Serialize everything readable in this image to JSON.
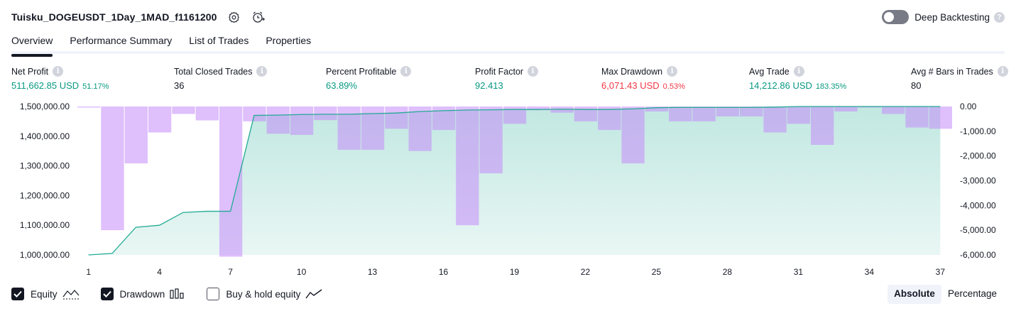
{
  "header": {
    "title": "Tuisku_DOGEUSDT_1Day_1MAD_f1161200",
    "settings_icon": "gear-icon",
    "alert_icon": "add-alert-clock-icon",
    "deep_backtesting_label": "Deep Backtesting",
    "deep_backtesting_enabled": false,
    "help_glyph": "?"
  },
  "tabs": [
    {
      "label": "Overview",
      "active": true
    },
    {
      "label": "Performance Summary",
      "active": false
    },
    {
      "label": "List of Trades",
      "active": false
    },
    {
      "label": "Properties",
      "active": false
    }
  ],
  "metrics": [
    {
      "label": "Net Profit",
      "value": "511,662.85 USD",
      "sub": "51.17%",
      "color": "#089981"
    },
    {
      "label": "Total Closed Trades",
      "value": "36",
      "sub": "",
      "color": "#131722"
    },
    {
      "label": "Percent Profitable",
      "value": "63.89%",
      "sub": "",
      "color": "#089981"
    },
    {
      "label": "Profit Factor",
      "value": "92.413",
      "sub": "",
      "color": "#089981"
    },
    {
      "label": "Max Drawdown",
      "value": "6,071.43 USD",
      "sub": "0.53%",
      "color": "#f23645"
    },
    {
      "label": "Avg Trade",
      "value": "14,212.86 USD",
      "sub": "183.35%",
      "color": "#089981"
    },
    {
      "label": "Avg # Bars in Trades",
      "value": "80",
      "sub": "",
      "color": "#131722"
    }
  ],
  "info_glyph": "i",
  "chart_data": {
    "type": "line+bar",
    "x": [
      1,
      2,
      3,
      4,
      5,
      6,
      7,
      8,
      9,
      10,
      11,
      12,
      13,
      14,
      15,
      16,
      17,
      18,
      19,
      20,
      21,
      22,
      23,
      24,
      25,
      26,
      27,
      28,
      29,
      30,
      31,
      32,
      33,
      34,
      35,
      36,
      37
    ],
    "x_tick_labels": [
      "1",
      "4",
      "7",
      "10",
      "13",
      "16",
      "19",
      "22",
      "25",
      "28",
      "31",
      "34",
      "37"
    ],
    "left_axis": {
      "ylim": [
        1000000,
        1500000
      ],
      "tick_values": [
        1500000,
        1400000,
        1300000,
        1200000,
        1100000,
        1000000
      ],
      "tick_labels": [
        "1,500,000.00",
        "1,400,000.00",
        "1,300,000.00",
        "1,200,000.00",
        "1,100,000.00",
        "1,000,000.00"
      ]
    },
    "right_axis": {
      "ylim": [
        -6000,
        0
      ],
      "tick_values": [
        0,
        -1000,
        -2000,
        -3000,
        -4000,
        -5000,
        -6000
      ],
      "tick_labels": [
        "0.00",
        "-1,000.00",
        "-2,000.00",
        "-3,000.00",
        "-4,000.00",
        "-5,000.00",
        "-6,000.00"
      ]
    },
    "series": [
      {
        "name": "Equity",
        "kind": "area",
        "axis": "left",
        "color": "#22ab94",
        "values": [
          1000000,
          1005000,
          1093000,
          1100000,
          1143000,
          1147000,
          1147000,
          1470000,
          1471000,
          1473000,
          1474000,
          1474000,
          1476000,
          1478000,
          1483000,
          1486000,
          1488000,
          1489000,
          1490000,
          1490000,
          1491000,
          1490000,
          1490000,
          1492000,
          1496000,
          1497000,
          1497000,
          1497000,
          1497000,
          1498000,
          1500000,
          1502000,
          1504000,
          1505000,
          1505000,
          1506000,
          1506000
        ]
      },
      {
        "name": "Drawdown",
        "kind": "bar",
        "axis": "right",
        "color": "#c58af9",
        "values": [
          0,
          -5000,
          -2300,
          -1050,
          -300,
          -560,
          -6071,
          -600,
          -1100,
          -1150,
          -550,
          -1750,
          -1750,
          -900,
          -1800,
          -950,
          -4800,
          -2700,
          -700,
          -150,
          -250,
          -600,
          -950,
          -2300,
          -200,
          -600,
          -600,
          -400,
          -400,
          -1050,
          -700,
          -1550,
          -200,
          0,
          -300,
          -850,
          -900
        ]
      }
    ],
    "grid": false,
    "legend": [
      {
        "label": "Equity",
        "checked": true,
        "icon": "area-line-icon"
      },
      {
        "label": "Drawdown",
        "checked": true,
        "icon": "bars-icon"
      },
      {
        "label": "Buy & hold equity",
        "checked": false,
        "icon": "line-icon"
      }
    ]
  },
  "view_toggle": {
    "options": [
      "Absolute",
      "Percentage"
    ],
    "selected": "Absolute"
  }
}
